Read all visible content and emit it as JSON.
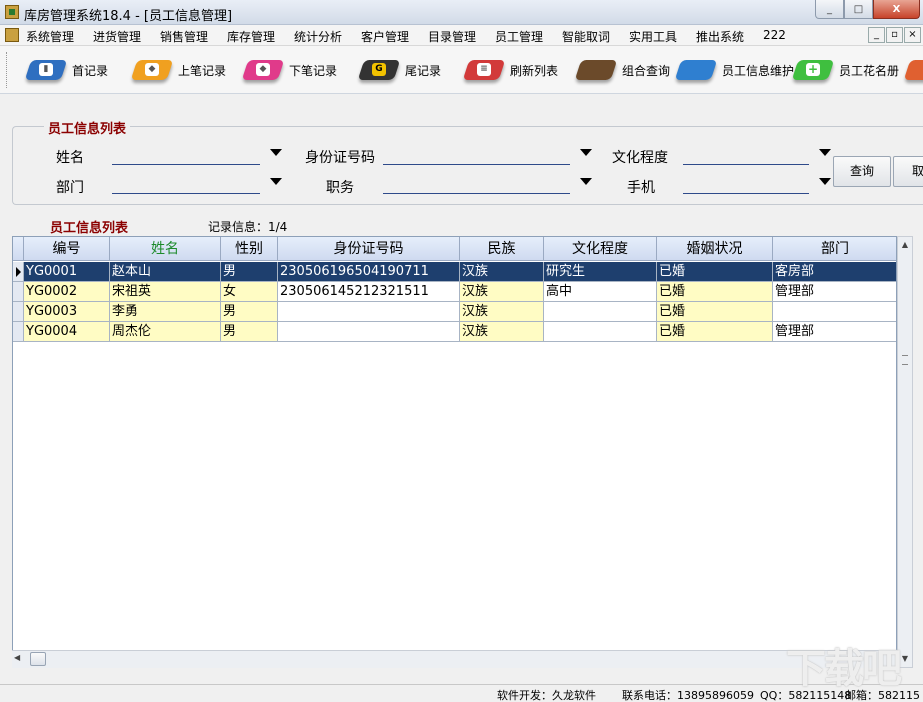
{
  "window": {
    "title": "库房管理系统18.4 - [员工信息管理]",
    "controls": [
      "_",
      "□",
      "X"
    ]
  },
  "menu": {
    "items": [
      "系统管理",
      "进货管理",
      "销售管理",
      "库存管理",
      "统计分析",
      "客户管理",
      "目录管理",
      "员工管理",
      "智能取词",
      "实用工具",
      "推出系统",
      "222"
    ],
    "mdi_controls": [
      "_",
      "▫",
      "×"
    ]
  },
  "toolbar": {
    "buttons": [
      {
        "label": "首记录",
        "color": "#2f6fc0",
        "glyph": "▮"
      },
      {
        "label": "上笔记录",
        "color": "#f0a020",
        "glyph": "◆"
      },
      {
        "label": "下笔记录",
        "color": "#e03a8a",
        "glyph": "◆"
      },
      {
        "label": "尾记录",
        "color": "#333333",
        "glyph": "G"
      },
      {
        "label": "刷新列表",
        "color": "#d23a3a",
        "glyph": "≡"
      },
      {
        "label": "组合查询",
        "color": "#6b4a2a",
        "glyph": ""
      },
      {
        "label": "员工信息维护",
        "color": "#2f7fd0",
        "glyph": ""
      },
      {
        "label": "员工花名册",
        "color": "#3fbf3f",
        "glyph": "+"
      },
      {
        "label": "",
        "color": "#e06030",
        "glyph": ""
      }
    ]
  },
  "search": {
    "group_title": "员工信息列表",
    "fields": [
      {
        "label": "姓名",
        "value": ""
      },
      {
        "label": "身份证号码",
        "value": ""
      },
      {
        "label": "文化程度",
        "value": ""
      },
      {
        "label": "部门",
        "value": ""
      },
      {
        "label": "职务",
        "value": ""
      },
      {
        "label": "手机",
        "value": ""
      }
    ],
    "query_button": "查询",
    "cancel_button": "取"
  },
  "list": {
    "title": "员工信息列表",
    "record_info": "记录信息：1/4"
  },
  "grid": {
    "columns": [
      "编号",
      "姓名",
      "性别",
      "身份证号码",
      "民族",
      "文化程度",
      "婚姻状况",
      "部门"
    ],
    "rows": [
      [
        "YG0001",
        "赵本山",
        "男",
        "230506196504190711",
        "汉族",
        "研究生",
        "已婚",
        "客房部"
      ],
      [
        "YG0002",
        "宋祖英",
        "女",
        "230506145212321511",
        "汉族",
        "高中",
        "已婚",
        "管理部"
      ],
      [
        "YG0003",
        "李勇",
        "男",
        "",
        "汉族",
        "",
        "已婚",
        ""
      ],
      [
        "YG0004",
        "周杰伦",
        "男",
        "",
        "汉族",
        "",
        "已婚",
        "管理部"
      ]
    ],
    "selected_row": 0
  },
  "status": {
    "developer": "软件开发：久龙软件",
    "phone": "联系电话：13895896059",
    "qq": "QQ：582115148",
    "email": "邮箱：582115"
  },
  "watermark": "下载吧"
}
